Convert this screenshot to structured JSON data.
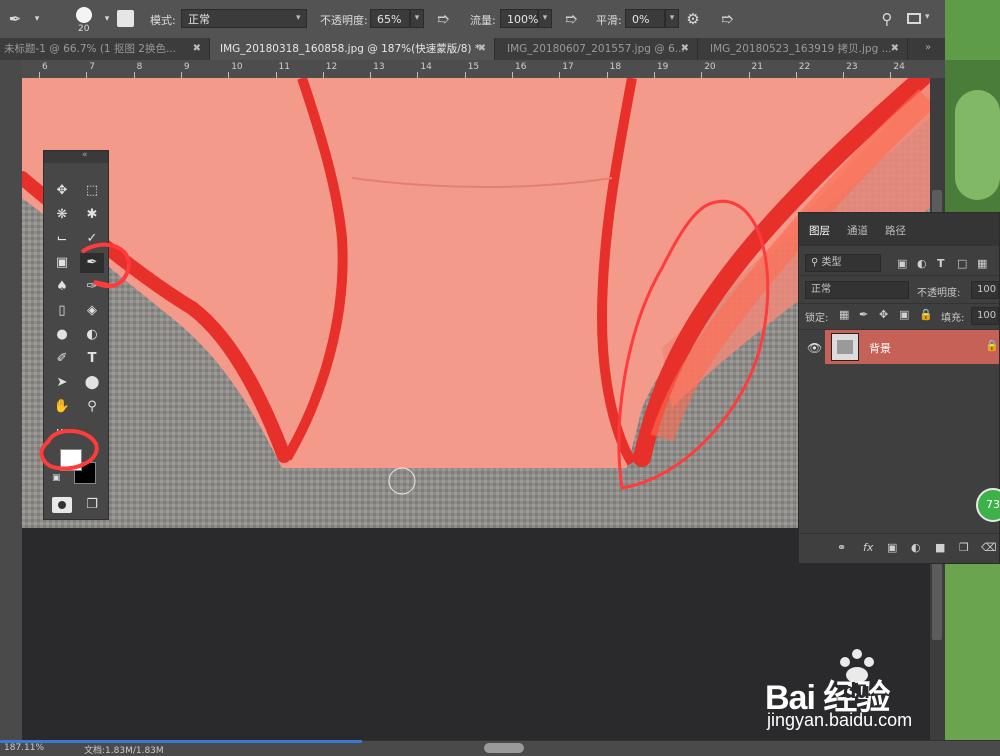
{
  "options_bar": {
    "brush_size": "20",
    "mode_label": "模式:",
    "mode_value": "正常",
    "opacity_label": "不透明度:",
    "opacity_value": "65%",
    "flow_label": "流量:",
    "flow_value": "100%",
    "smoothing_label": "平滑:",
    "smoothing_value": "0%"
  },
  "tabs": [
    {
      "label": "未标题-1 @ 66.7% (1 抠图 2换色..."
    },
    {
      "label": "IMG_20180318_160858.jpg @ 187%(快速蒙版/8) *"
    },
    {
      "label": "IMG_20180607_201557.jpg @ 6..."
    },
    {
      "label": "IMG_20180523_163919 拷贝.jpg ..."
    }
  ],
  "ruler": {
    "ticks": [
      "6",
      "7",
      "8",
      "9",
      "10",
      "11",
      "12",
      "13",
      "14",
      "15",
      "16",
      "17",
      "18",
      "19",
      "20",
      "21",
      "22",
      "23",
      "24"
    ]
  },
  "layers_panel": {
    "tabs": [
      "图层",
      "通道",
      "路径"
    ],
    "filter_placeholder": "类型",
    "blend_mode": "正常",
    "opacity_label": "不透明度:",
    "opacity_value": "100",
    "lock_label": "锁定:",
    "fill_label": "填充:",
    "fill_value": "100",
    "layer_name": "背景",
    "badge_text": "73"
  },
  "status_bar": {
    "zoom": "187.11%",
    "doc_info": "文档:1.83M/1.83M"
  },
  "watermark": {
    "brand_text": "Bai  经验",
    "brand_du": "du",
    "url": "jingyan.baidu.com"
  },
  "colors": {
    "mask_red": "#e8302a",
    "mask_overlay": "#f28b7e",
    "panel_bg": "#3f3f3f",
    "layer_highlight": "#c66157",
    "annotation_red": "#ff3b3b"
  }
}
